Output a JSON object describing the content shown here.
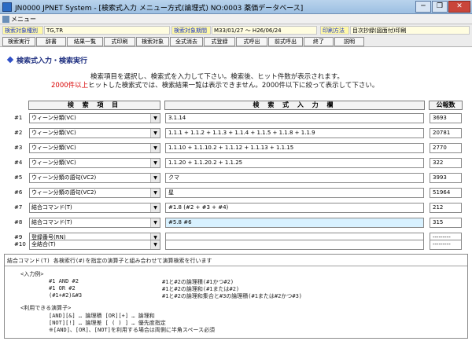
{
  "window": {
    "title": "JN0000 JPNET System - [検索式入力 メニュー方式(論理式) NO:0003 薬価データベース]",
    "minimize": "─",
    "restore": "❐",
    "close": "✕"
  },
  "menu": {
    "label": "メニュー"
  },
  "status": {
    "target_type_label": "検索対象種別",
    "target_type_value": "TG,TR",
    "target_period_label": "検索対象期間",
    "target_period_value": "M33/01/27 ～ H26/06/24",
    "print_method_label": "印刷方法",
    "print_method_value": "目次抄録(図面付)印刷"
  },
  "toolbar": [
    "検索実行",
    "辞書",
    "結果一覧",
    "式印刷",
    "検索対象",
    "全式消去",
    "式登録",
    "式呼出",
    "前式呼出",
    "終了",
    "説明"
  ],
  "section": {
    "title": "検索式入力・検索実行",
    "desc1": "検索項目を選択し、検索式を入力して下さい。検索後、ヒット件数が表示されます。",
    "desc2_red": "2000件以上",
    "desc2_rest": "ヒットした検索式では、検索結果一覧は表示できません。2000件以下に絞って表示して下さい。"
  },
  "table": {
    "headers": {
      "item": "検 索 項 目",
      "expr": "検 索 式 入 力 欄",
      "count": "公報数"
    },
    "arrow": "▼",
    "rows": [
      {
        "num": "#1",
        "item": "ウィーン分類(VC)",
        "expr": "3.1.14",
        "count": "3693"
      },
      {
        "num": "#2",
        "item": "ウィーン分類(VC)",
        "expr": "1.1.1 + 1.1.2 + 1.1.3 + 1.1.4 + 1.1.5 + 1.1.8 + 1.1.9",
        "count": "20781"
      },
      {
        "num": "#3",
        "item": "ウィーン分類(VC)",
        "expr": "1.1.10 + 1.1.10.2 + 1.1.12 + 1.1.13 + 1.1.15",
        "count": "2770"
      },
      {
        "num": "#4",
        "item": "ウィーン分類(VC)",
        "expr": "1.1.20 + 1.1.20.2 + 1.1.25",
        "count": "322"
      },
      {
        "num": "#5",
        "item": "ウィーン分類の語句(VC2)",
        "expr": "クマ",
        "count": "3993"
      },
      {
        "num": "#6",
        "item": "ウィーン分類の語句(VC2)",
        "expr": "星",
        "count": "51964"
      },
      {
        "num": "#7",
        "item": "結合コマンド(T)",
        "expr": "#1.8 (#2 + #3 + #4)",
        "count": "212"
      },
      {
        "num": "#8",
        "item": "結合コマンド(T)",
        "expr": "#5.8 #6",
        "count": "315"
      },
      {
        "num": "#9",
        "item": "登録番号(RN)",
        "expr": "",
        "count": "---------"
      },
      {
        "num": "#10",
        "item": "全結合(T)",
        "expr": "",
        "count": "---------"
      }
    ]
  },
  "info": {
    "head": "結合コマンド(T)  各検索行(#)を指定の演算子と組み合わせて演算検索を行います",
    "example_heading": "<入力例>",
    "examples": [
      {
        "cmd": "#1 AND #2",
        "desc": "#1と#2の論理積(#1かつ#2)"
      },
      {
        "cmd": "#1 OR #2",
        "desc": "#1と#2の論理和(#1または#2)"
      },
      {
        "cmd": "(#1+#2)&#3",
        "desc": "#1と#2の論理和集合と#3の論理積(#1または#2かつ#3)"
      }
    ],
    "ops_heading": "<利用できる演算子>",
    "ops": [
      "[AND][&] … 論理積    [OR][+] … 論理和",
      "[NOT][!] … 論理差    [ ( ) ]  … 優先度指定",
      "※[AND]、[OR]、[NOT]を利用する場合は両側に半角スペース必須"
    ]
  }
}
